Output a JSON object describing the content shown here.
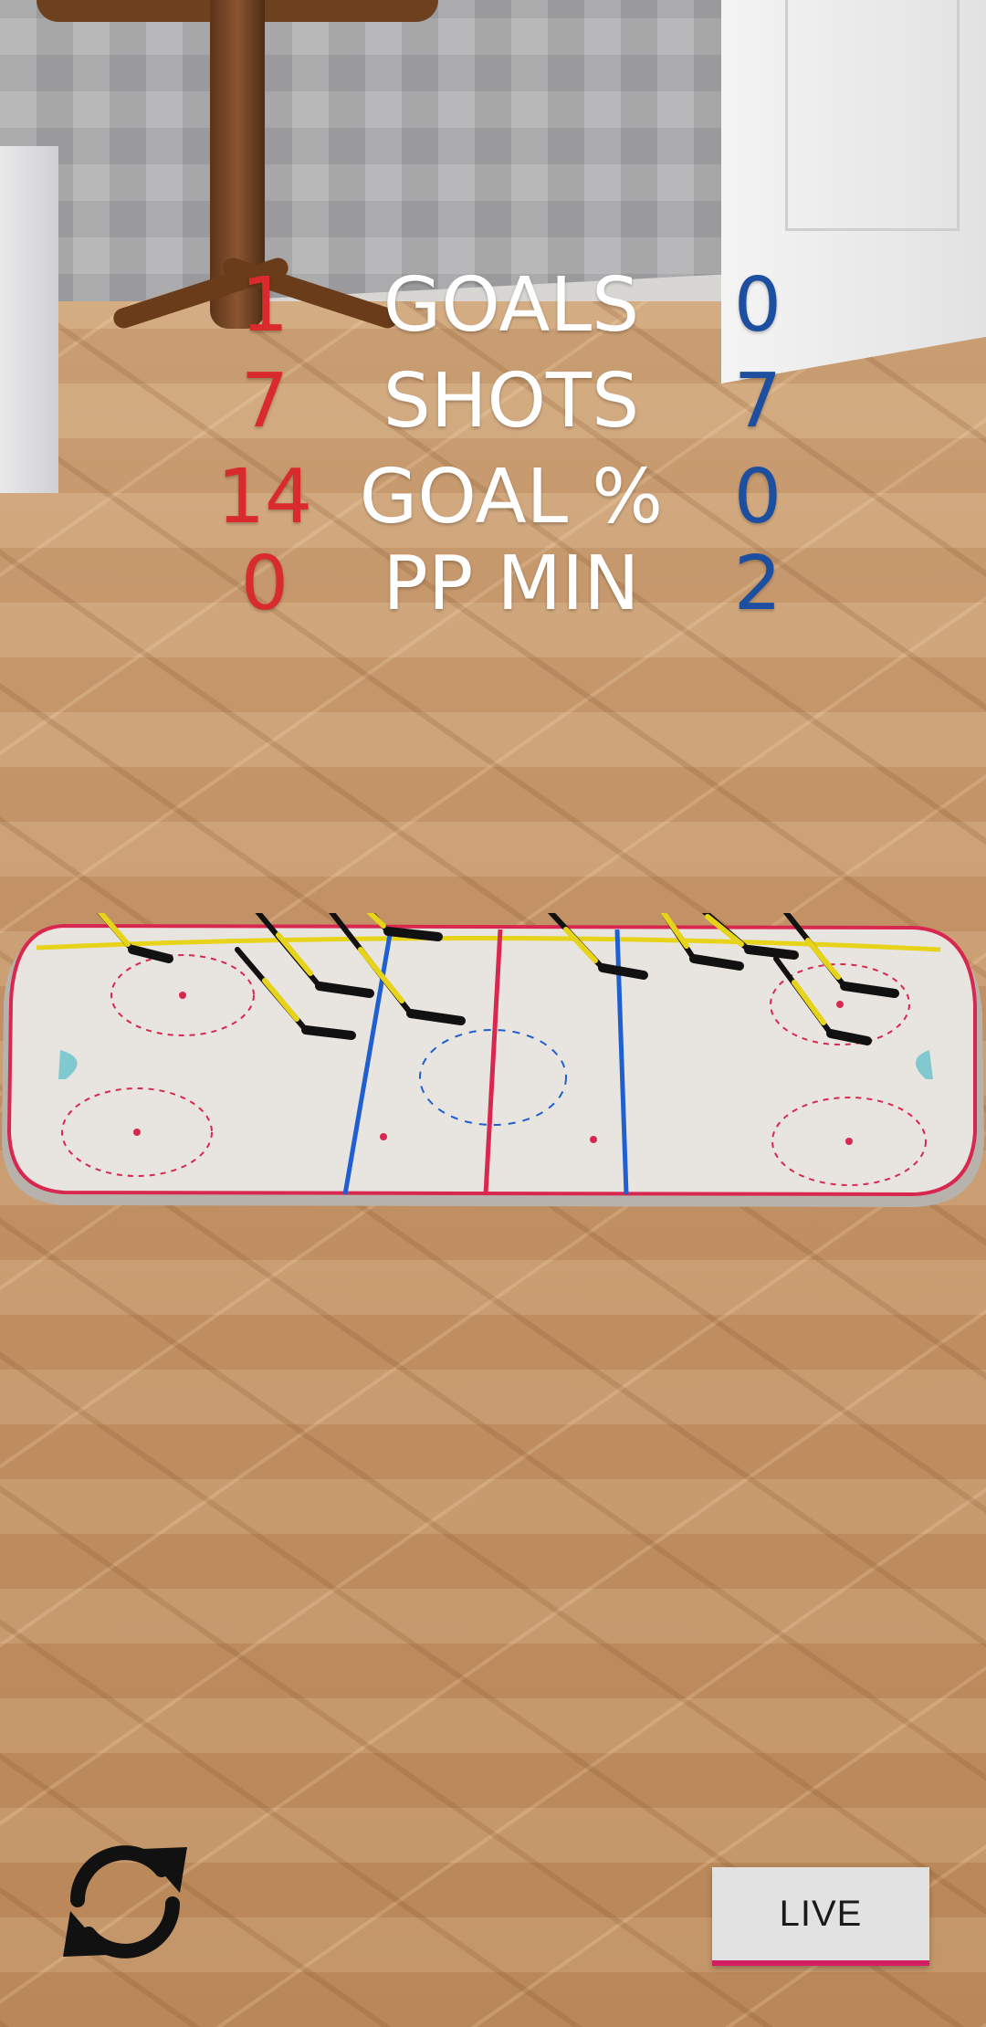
{
  "scoreboard": {
    "rows": [
      {
        "home": "1",
        "label": "GOALS",
        "away": "0"
      },
      {
        "home": "7",
        "label": "SHOTS",
        "away": "7"
      },
      {
        "home": "14",
        "label": "GOAL %",
        "away": "0"
      },
      {
        "home": "0",
        "label": "PP MIN",
        "away": "2"
      }
    ],
    "colors": {
      "home": "#d92b2e",
      "away": "#1d4fa0",
      "label": "#ffffff"
    }
  },
  "controls": {
    "refresh_icon": "refresh-icon",
    "live_label": "LIVE",
    "live_accent": "#d21e63"
  },
  "rink": {
    "line_colors": {
      "red": "#d8284f",
      "blue": "#1f5fd0",
      "yellow": "#e7d319"
    }
  }
}
